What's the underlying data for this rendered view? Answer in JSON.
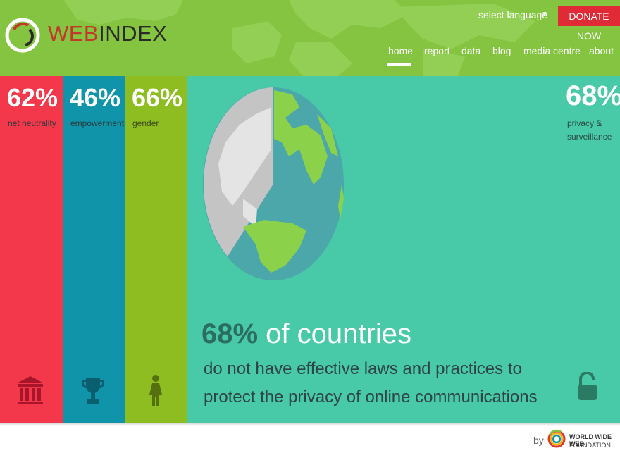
{
  "header": {
    "logo_text_a": "WEB",
    "logo_text_b": "INDEX",
    "select_language": "select language",
    "donate": "DONATE NOW",
    "nav": [
      {
        "label": "home",
        "active": true
      },
      {
        "label": "report"
      },
      {
        "label": "data"
      },
      {
        "label": "blog"
      },
      {
        "label": "media centre"
      },
      {
        "label": "about"
      }
    ]
  },
  "panels": [
    {
      "pct": "62%",
      "label": "net neutrality",
      "color": "#f2384a",
      "icon": "bank-icon"
    },
    {
      "pct": "46%",
      "label": "empowerment",
      "color": "#0f94aa",
      "icon": "trophy-icon"
    },
    {
      "pct": "66%",
      "label": "gender",
      "color": "#8ebd21",
      "icon": "woman-icon"
    }
  ],
  "feature": {
    "pct": "68%",
    "label_line1": "privacy &",
    "label_line2": "surveillance",
    "color": "#48c9a7",
    "headline_strong": "68%",
    "headline_rest": " of countries",
    "sub_line1": "do not have effective laws and practices to",
    "sub_line2": "protect the privacy of online communications",
    "icon": "unlock-icon"
  },
  "footer": {
    "by": "by",
    "org_line1": "WORLD WIDE WEB",
    "org_line2": "FOUNDATION"
  }
}
